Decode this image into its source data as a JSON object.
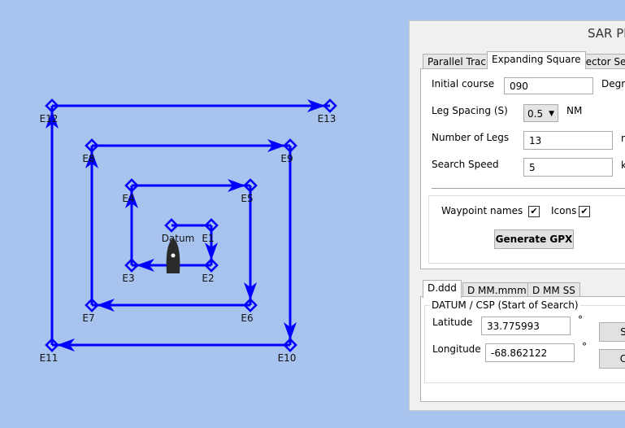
{
  "map": {
    "waypoints": [
      "Datum",
      "E1",
      "E2",
      "E3",
      "E4",
      "E5",
      "E6",
      "E7",
      "E8",
      "E9",
      "E10",
      "E11",
      "E12",
      "E13"
    ],
    "track_color": "#0000ff",
    "background": "#a9c3ef",
    "vessel_icon": "boat-icon"
  },
  "panel": {
    "title": "SAR Plu",
    "tabs": [
      "Parallel Track",
      "Expanding Square",
      "Sector Sear"
    ],
    "active_tab": "Expanding Square",
    "initial_course_label": "Initial course",
    "initial_course_value": "090",
    "initial_course_unit": "Degre",
    "leg_spacing_label": "Leg Spacing (S)",
    "leg_spacing_value": "0.5",
    "leg_spacing_unit": "NM",
    "legs_label": "Number of Legs",
    "legs_value": "13",
    "legs_unit": "n",
    "speed_label": "Search Speed",
    "speed_value": "5",
    "speed_unit": "k",
    "waypoint_names_label": "Waypoint names",
    "waypoint_names_checked": true,
    "icons_label": "Icons",
    "icons_checked": true,
    "check_mark": "✔",
    "generate_label": "Generate GPX",
    "coord_tabs": [
      "D.ddd",
      "D MM.mmm",
      "D MM SS"
    ],
    "group_label": "DATUM / CSP (Start of Search)",
    "latitude_label": "Latitude",
    "latitude_value": "33.775993",
    "longitude_label": "Longitude",
    "longitude_value": "-68.862122",
    "degree_symbol": "°",
    "button1_label": "S",
    "button2_label": "C"
  }
}
